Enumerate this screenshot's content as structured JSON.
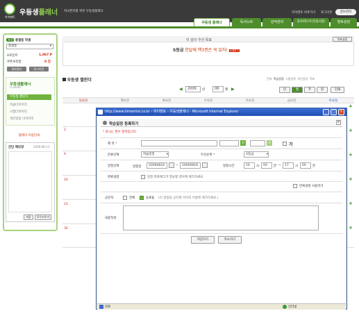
{
  "header": {
    "logo_text": "하이멘토",
    "brand_main": "우등생",
    "brand_accent": "플래너",
    "brand_sub": "자녀관리를 위한 우등생플래너",
    "top_links": [
      "하이멘토 바로가기",
      "로그아웃"
    ],
    "login_btn": "정보관리",
    "tabs": [
      "우등생 플래너",
      "독서노트",
      "성적관리",
      "검사/테스트(인증시험)",
      "멘토상담"
    ]
  },
  "sidebar": {
    "badge": "자녀",
    "heading": "중결등 학생",
    "select_value": "중결등",
    "stats": [
      {
        "label": "H포인트",
        "value": "1,067 P"
      },
      {
        "label": "쿠폰보관함",
        "value": "0 건"
      }
    ],
    "buttons": [
      "정보관리",
      "로그아웃"
    ],
    "menu_title": "우등생플래너",
    "menu_sub": "PLANNER",
    "menu_items": [
      "우등생 캘린더",
      "학습다이어리",
      "시험다이어리",
      "개인일정 다이어리"
    ],
    "link": "플래너 이용안내",
    "memo_title": "간단 메모장",
    "memo_date": "2009-08-13",
    "memo_buttons": [
      "저장",
      "모두지우기"
    ]
  },
  "main": {
    "notice_title": "이 달의 우선 목표",
    "notice_btn": "목표설정",
    "notice_grade": "S등급",
    "notice_text": " 한달에 책3권은 꼭 읽자!",
    "notice_badge": "수정하기",
    "calendar_title": "우등생 캘린더",
    "legend": [
      "전체",
      "학습일정",
      "시험일정",
      "개인일정",
      "목표"
    ],
    "year": "2009",
    "year_suffix": "년",
    "month": "08",
    "month_suffix": "월",
    "view_buttons": [
      "년",
      "월",
      "주",
      "일"
    ],
    "print_btn": "인쇄",
    "days": [
      "일요일",
      "월요일",
      "화요일",
      "수요일",
      "목요일",
      "금요일",
      "토요일"
    ],
    "week_nums": [
      "2",
      "9",
      "16",
      "23",
      "30"
    ]
  },
  "popup": {
    "title": "http://www.himentor.co.kr - 하이멘토 - 우등생플래너 - Microsoft Internet Explorer",
    "heading": "학습일정 등록하기",
    "required_note": "* 표시는 필수 항목입니다.",
    "fields": {
      "title_label": "제 목",
      "category_label": "분류선택",
      "category_value": "자습일정",
      "priority_label": "우선순위",
      "priority_value": "A등급",
      "date_label": "일정선택",
      "date_start_label": "일정일",
      "date_start": "20090818",
      "date_tilde": "~",
      "date_end": "20090818",
      "time_label": "일정시간",
      "time_start_h": "16",
      "time_h": "시",
      "time_start_m": "00",
      "time_m": "분",
      "time_tilde": "~",
      "time_end_h": "17",
      "time_end_m": "00",
      "complete_label": "완료설정",
      "complete_text": "일정 완료체크가 필요할 경우에 체크하세요.",
      "repeat_text": "반복설정 사용하기",
      "share_label": "공유자",
      "share_all": "전체",
      "share_friends": "동료들",
      "share_hint": "(이 일정을 공유할 아이의 이름에 체크하세요.)",
      "content_label": "내용작성",
      "ga_text": "가",
      "cal_text": "달"
    },
    "buttons": [
      "저장하기",
      "취소하기"
    ],
    "status_left": "완료",
    "status_right": "인터넷"
  },
  "colors": {
    "brand_green": "#4e8d2c",
    "accent_red": "#cc2200",
    "ie_blue": "#2a5bc3"
  }
}
